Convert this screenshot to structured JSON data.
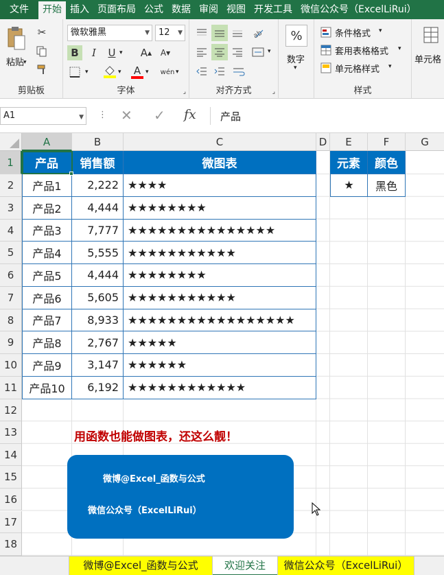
{
  "ribbon_tabs": [
    "文件",
    "开始",
    "插入",
    "页面布局",
    "公式",
    "数据",
    "审阅",
    "视图",
    "开发工具",
    "微信公众号（ExcelLiRui）"
  ],
  "ribbon": {
    "paste_label": "粘贴",
    "clipboard_group": "剪贴板",
    "font_name": "微软雅黑",
    "font_size": "12",
    "font_group": "字体",
    "align_group": "对齐方式",
    "number_label": "数字",
    "number_icon": "%",
    "cond_format": "条件格式",
    "table_format": "套用表格格式",
    "cell_style": "单元格样式",
    "styles_group": "样式",
    "cells_label": "单元格",
    "bold": "B",
    "italic": "I",
    "underline": "U",
    "grow_font": "A",
    "shrink_font": "A",
    "font_color": "A",
    "phonetic": "wén"
  },
  "formula_bar": {
    "name_box": "A1",
    "fx": "fx",
    "content": "产品"
  },
  "columns": [
    "A",
    "B",
    "C",
    "D",
    "E",
    "F",
    "G"
  ],
  "rows": [
    "1",
    "2",
    "3",
    "4",
    "5",
    "6",
    "7",
    "8",
    "9",
    "10",
    "11",
    "12",
    "13",
    "14",
    "15",
    "16",
    "17",
    "18"
  ],
  "table": {
    "headers": [
      "产品",
      "销售额",
      "微图表"
    ],
    "rows": [
      [
        "产品1",
        "2,222",
        "★★★★"
      ],
      [
        "产品2",
        "4,444",
        "★★★★★★★★"
      ],
      [
        "产品3",
        "7,777",
        "★★★★★★★★★★★★★★★"
      ],
      [
        "产品4",
        "5,555",
        "★★★★★★★★★★★"
      ],
      [
        "产品5",
        "4,444",
        "★★★★★★★★"
      ],
      [
        "产品6",
        "5,605",
        "★★★★★★★★★★★"
      ],
      [
        "产品7",
        "8,933",
        "★★★★★★★★★★★★★★★★★"
      ],
      [
        "产品8",
        "2,767",
        "★★★★★"
      ],
      [
        "产品9",
        "3,147",
        "★★★★★★"
      ],
      [
        "产品10",
        "6,192",
        "★★★★★★★★★★★★"
      ]
    ]
  },
  "params": {
    "headers": [
      "元素",
      "颜色"
    ],
    "values": [
      "★",
      "黑色"
    ]
  },
  "tagline": "用函数也能做图表，还这么靓！",
  "banner": {
    "line1": "微博@Excel_函数与公式",
    "line2": "微信公众号（ExcelLiRui）"
  },
  "sheet_tabs": [
    "微博@Excel_函数与公式",
    "欢迎关注",
    "微信公众号（ExcelLiRui）"
  ],
  "colors": {
    "excel_green": "#217346",
    "header_blue": "#0070c0",
    "tagline_red": "#c00000",
    "sheet_tab_yellow": "#ffff00"
  }
}
